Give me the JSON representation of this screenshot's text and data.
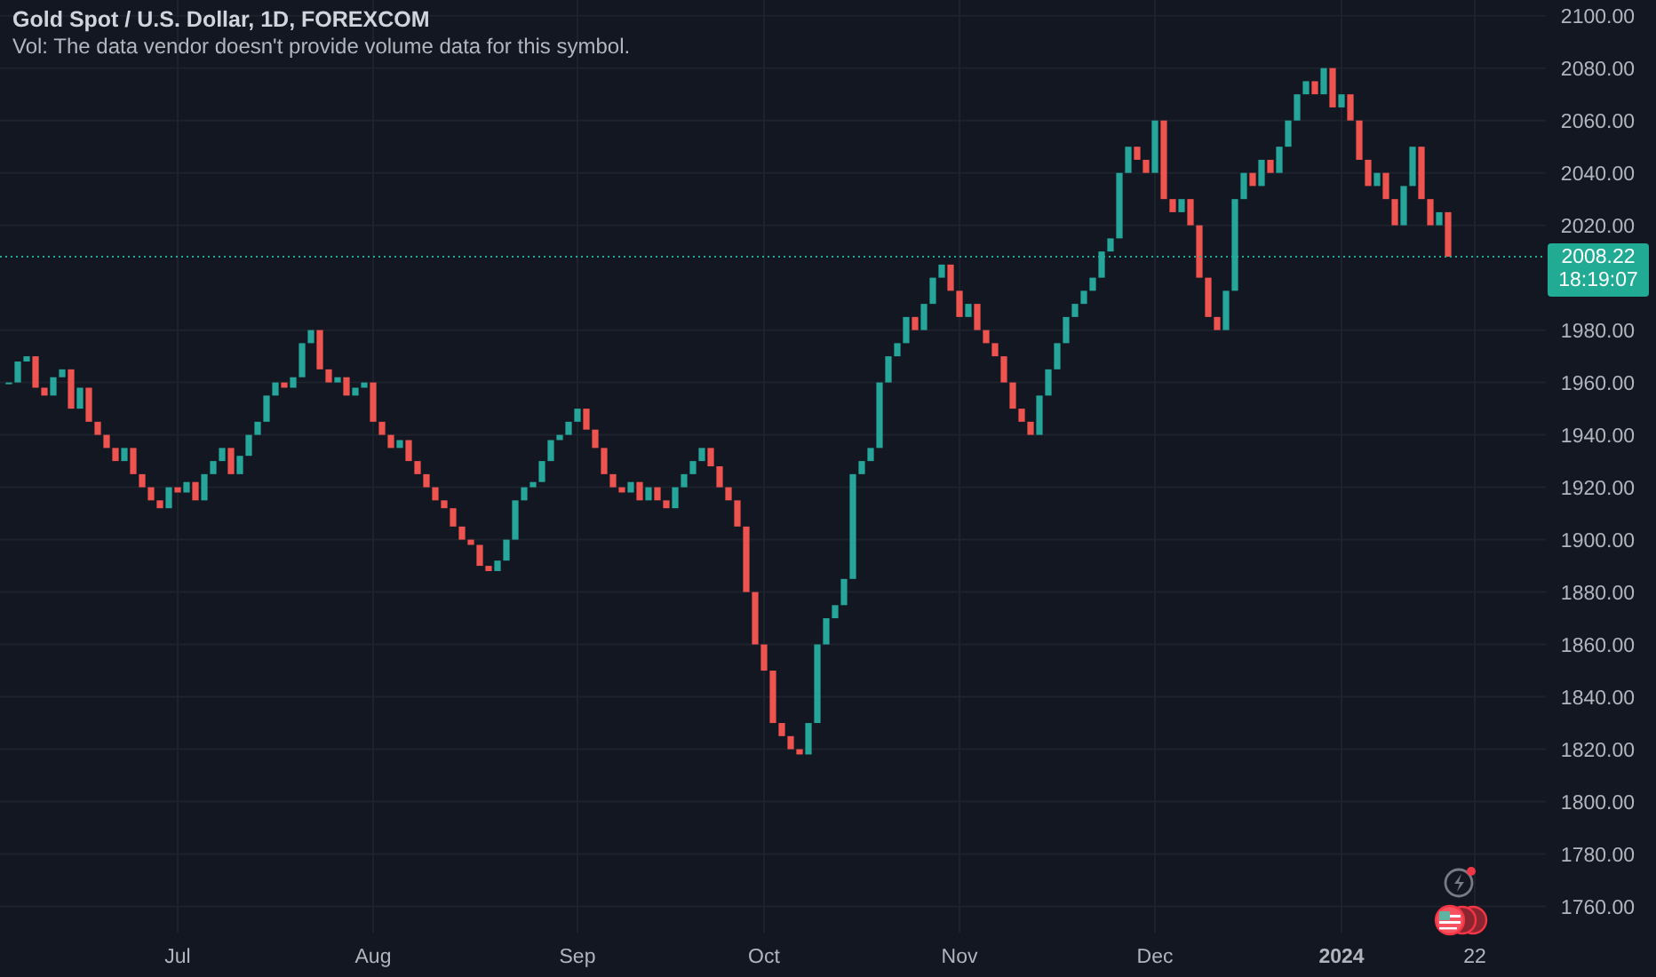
{
  "legend": {
    "title": "Gold Spot / U.S. Dollar, 1D, FOREXCOM",
    "volume_note": "Vol: The data vendor doesn't provide volume data for this symbol."
  },
  "price_tag": {
    "price": "2008.22",
    "countdown": "18:19:07"
  },
  "price_axis": {
    "labels": [
      "2100.00",
      "2080.00",
      "2060.00",
      "2040.00",
      "2020.00",
      "1980.00",
      "1960.00",
      "1940.00",
      "1920.00",
      "1900.00",
      "1880.00",
      "1860.00",
      "1840.00",
      "1820.00",
      "1800.00",
      "1780.00",
      "1760.00"
    ]
  },
  "time_axis": {
    "labels": [
      {
        "text": "Jul",
        "bold": false
      },
      {
        "text": "Aug",
        "bold": false
      },
      {
        "text": "Sep",
        "bold": false
      },
      {
        "text": "Oct",
        "bold": false
      },
      {
        "text": "Nov",
        "bold": false
      },
      {
        "text": "Dec",
        "bold": false
      },
      {
        "text": "2024",
        "bold": true
      },
      {
        "text": "22",
        "bold": false
      }
    ]
  }
}
